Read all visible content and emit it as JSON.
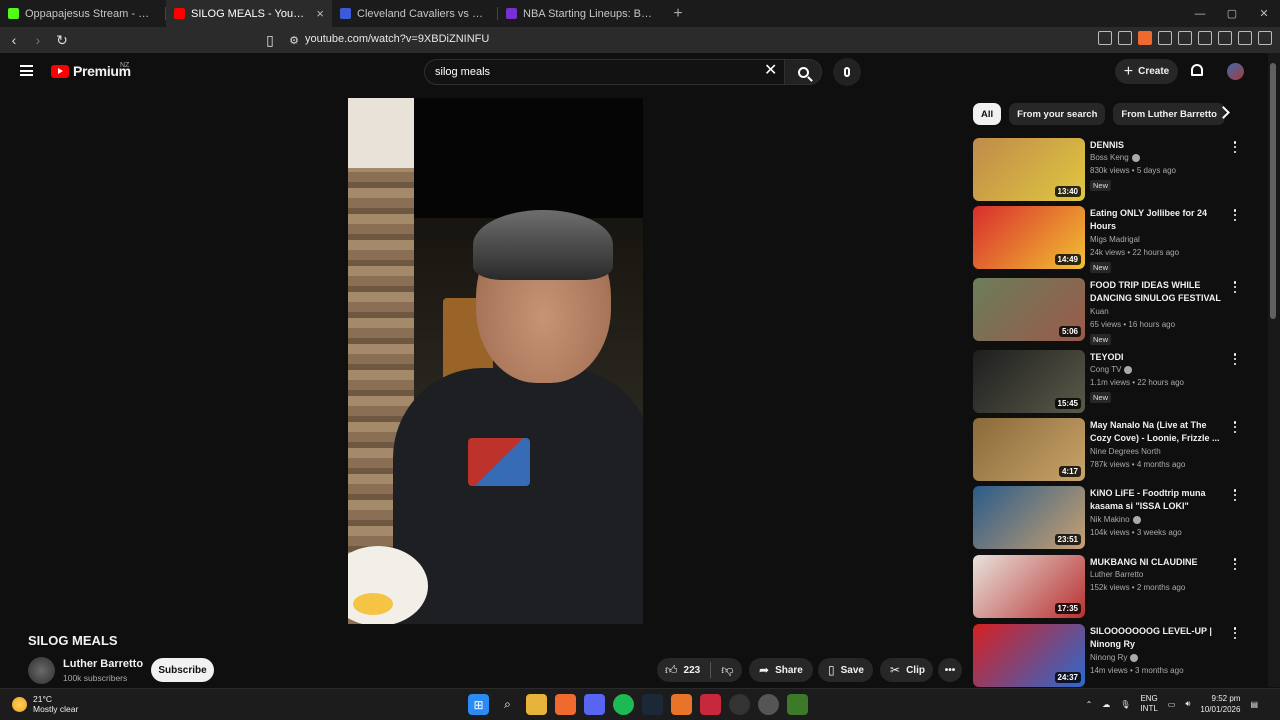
{
  "browser": {
    "tabs": [
      {
        "title": "Oppapajesus Stream - Watch Live on",
        "color": "#53fc18",
        "active": false
      },
      {
        "title": "SILOG MEALS - YouTube",
        "color": "#ff0000",
        "active": true
      },
      {
        "title": "Cleveland Cavaliers vs Minnesota Tim",
        "color": "#3b5bdb",
        "active": false
      },
      {
        "title": "NBA Starting Lineups: Basketball Da",
        "color": "#7a2fd0",
        "active": false
      }
    ],
    "url": "youtube.com/watch?v=9XBDiZNINFU"
  },
  "youtube": {
    "logo_text": "Premium",
    "region": "NZ",
    "search_value": "silog meals",
    "create_label": "Create"
  },
  "video": {
    "title": "SILOG MEALS",
    "channel": "Luther Barretto",
    "subscribers": "100k subscribers",
    "subscribe_label": "Subscribe",
    "likes": "223",
    "share_label": "Share",
    "save_label": "Save",
    "clip_label": "Clip"
  },
  "sidebar": {
    "chips": [
      "All",
      "From your search",
      "From Luther Barretto"
    ],
    "items": [
      {
        "title": "DENNIS",
        "channel": "Boss Keng",
        "verified": true,
        "stats": "830k views • 5 days ago",
        "new": "New",
        "duration": "13:40",
        "c1": "#c08a4a",
        "c2": "#e0c840"
      },
      {
        "title": "Eating ONLY Jollibee for 24 Hours",
        "channel": "Migs Madrigal",
        "verified": false,
        "stats": "24k views • 22 hours ago",
        "new": "New",
        "duration": "14:49",
        "c1": "#d92d2d",
        "c2": "#f1c232"
      },
      {
        "title": "FOOD TRIP IDEAS WHILE DANCING SINULOG FESTIVAL ...",
        "channel": "Kuan",
        "verified": false,
        "stats": "65 views • 16 hours ago",
        "new": "New",
        "duration": "5:06",
        "c1": "#6b7d5a",
        "c2": "#9a5a4a"
      },
      {
        "title": "TEYODI",
        "channel": "Cong TV",
        "verified": true,
        "stats": "1.1m views • 22 hours ago",
        "new": "New",
        "duration": "15:45",
        "c1": "#1e1e1e",
        "c2": "#5a5a4a"
      },
      {
        "title": "May Nanalo Na (Live at The Cozy Cove) - Loonie, Frizzle ...",
        "channel": "Nine Degrees North",
        "verified": false,
        "stats": "787k views • 4 months ago",
        "new": "",
        "duration": "4:17",
        "c1": "#8a6a3a",
        "c2": "#c9a46a"
      },
      {
        "title": "KiNO LiFE - Foodtrip muna kasama si \"ISSA LOKI\"",
        "channel": "Nik Makino",
        "verified": true,
        "stats": "104k views • 3 weeks ago",
        "new": "",
        "duration": "23:51",
        "c1": "#2a5c8a",
        "c2": "#c9a070"
      },
      {
        "title": "MUKBANG NI CLAUDINE",
        "channel": "Luther Barretto",
        "verified": false,
        "stats": "152k views • 2 months ago",
        "new": "",
        "duration": "17:35",
        "c1": "#e8e2dc",
        "c2": "#b83030"
      },
      {
        "title": "SILOOOOOOOG LEVEL-UP | Ninong Ry",
        "channel": "Ninong Ry",
        "verified": true,
        "stats": "14m views • 3 months ago",
        "new": "",
        "duration": "24:37",
        "c1": "#d62020",
        "c2": "#2a6ad0"
      }
    ]
  },
  "taskbar": {
    "temp": "21°C",
    "weather": "Mostly clear",
    "lang1": "ENG",
    "lang2": "INTL",
    "time": "9:52 pm",
    "date": "10/01/2026"
  }
}
